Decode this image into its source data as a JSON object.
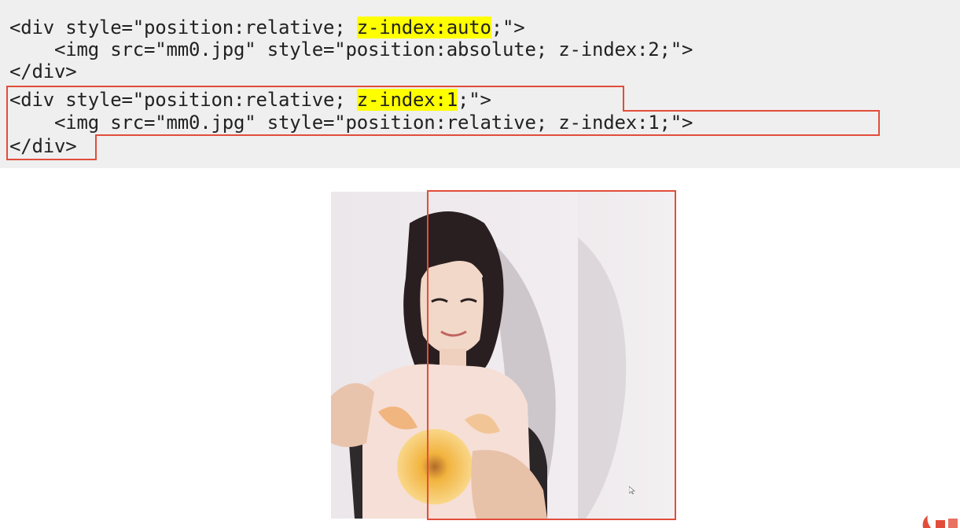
{
  "code": {
    "line1_a": "<div style=\"position:relative; ",
    "line1_hl": "z-index:auto",
    "line1_b": ";\">",
    "line2": "    <img src=\"mm0.jpg\" style=\"position:absolute; z-index:2;\">",
    "line3": "</div>",
    "line4_a": "<div style=\"position:relative; ",
    "line4_hl": "z-index:1",
    "line4_b": ";\">",
    "line5": "    <img src=\"mm0.jpg\" style=\"position:relative; z-index:1;\">",
    "line6": "</div>"
  },
  "colors": {
    "highlight": "#ffff00",
    "callout": "#e24d3b",
    "panel": "#efefef"
  }
}
